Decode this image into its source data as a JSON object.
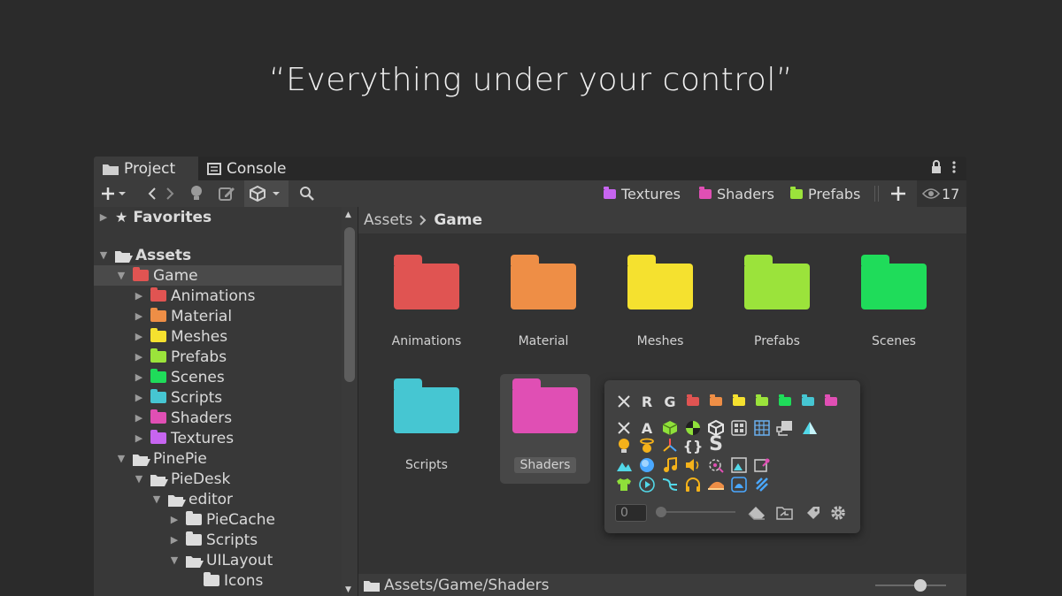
{
  "headline": "“Everything under your control”",
  "tabs": {
    "project": "Project",
    "console": "Console"
  },
  "toolbar": {
    "favorites": [
      {
        "label": "Textures",
        "color": "#c765f0"
      },
      {
        "label": "Shaders",
        "color": "#e04fb4"
      },
      {
        "label": "Prefabs",
        "color": "#9be33b"
      }
    ],
    "hidden_count": "17"
  },
  "tree": {
    "favorites": "Favorites",
    "assets": "Assets",
    "game": "Game",
    "animations": "Animations",
    "material": "Material",
    "meshes": "Meshes",
    "prefabs": "Prefabs",
    "scenes": "Scenes",
    "scripts": "Scripts",
    "shaders": "Shaders",
    "textures": "Textures",
    "piepie": "PinePie",
    "piedesk": "PieDesk",
    "editor": "editor",
    "piecache": "PieCache",
    "scripts2": "Scripts",
    "uilayout": "UILayout",
    "icons": "Icons"
  },
  "breadcrumb": {
    "root": "Assets",
    "current": "Game"
  },
  "grid": [
    {
      "label": "Animations",
      "color": "#e05452"
    },
    {
      "label": "Material",
      "color": "#ee8e46"
    },
    {
      "label": "Meshes",
      "color": "#f5e12f"
    },
    {
      "label": "Prefabs",
      "color": "#9be33b"
    },
    {
      "label": "Scenes",
      "color": "#1fdc5a"
    },
    {
      "label": "Scripts",
      "color": "#46c6d2"
    },
    {
      "label": "Shaders",
      "color": "#e04fb4"
    }
  ],
  "popup": {
    "row1_letters": [
      "R",
      "G"
    ],
    "row2_letters": [
      "A"
    ],
    "row2_bracket": "{}",
    "row2_s": "S",
    "swatches": [
      "#e05452",
      "#ee8e46",
      "#f5e12f",
      "#9be33b",
      "#1fdc5a",
      "#46c6d2",
      "#e04fb4"
    ],
    "number_value": "0"
  },
  "status": {
    "path": "Assets/Game/Shaders"
  }
}
